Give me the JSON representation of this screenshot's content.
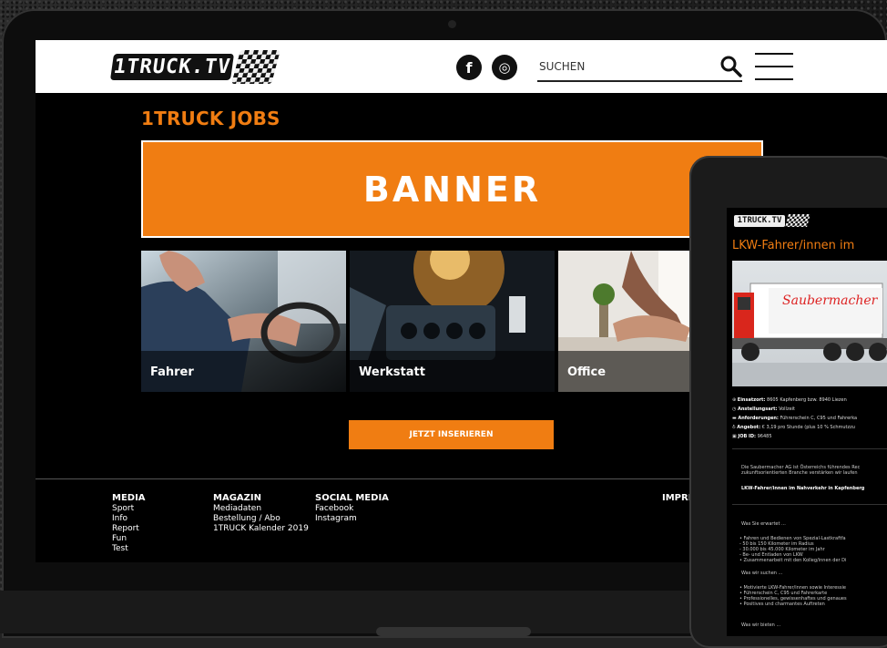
{
  "header": {
    "logo_text": "1TRUCK.TV",
    "social": [
      {
        "label": "f",
        "icon": "facebook-icon"
      },
      {
        "label": "◎",
        "icon": "instagram-icon"
      }
    ],
    "search_placeholder": "SUCHEN"
  },
  "main": {
    "title": "1TRUCK JOBS",
    "banner": "BANNER",
    "categories": [
      {
        "label": "Fahrer"
      },
      {
        "label": "Werkstatt"
      },
      {
        "label": "Office"
      }
    ],
    "cta": "JETZT INSERIEREN"
  },
  "footer": {
    "columns": [
      {
        "heading": "MEDIA",
        "items": [
          "Sport",
          "Info",
          "Report",
          "Fun",
          "Test"
        ]
      },
      {
        "heading": "MAGAZIN",
        "items": [
          "Mediadaten",
          "Bestellung / Abo",
          "1TRUCK Kalender 2019"
        ]
      },
      {
        "heading": "SOCIAL MEDIA",
        "items": [
          "Facebook",
          "Instagram"
        ]
      },
      {
        "heading": "IMPRI",
        "items": []
      }
    ]
  },
  "tablet": {
    "logo_text": "1TRUCK.TV",
    "title": "LKW-Fahrer/innen im",
    "truck_text": "Saubermacher",
    "meta": [
      {
        "k": "Einsatzort:",
        "v": " 8605 Kapfenberg bzw. 8940 Liezen"
      },
      {
        "k": "Anstellungsart:",
        "v": " Vollzeit"
      },
      {
        "k": "Anforderungen:",
        "v": " Führerschein C, C95 und Fahrerka"
      },
      {
        "k": "Angebot:",
        "v": " € 3,19 pro Stunde (plus 10 % Schmutzzu"
      },
      {
        "k": "JOB ID:",
        "v": " 96485"
      }
    ],
    "intro": [
      "Die Saubermacher AG ist Österreichs führendes Rec",
      "zukunftsorientierten Branche verstärken wir laufen"
    ],
    "subheading": "LKW-Fahrer/innen im Nahverkehr in Kapfenberg",
    "section1": "Was Sie erwartet ...",
    "list1": [
      "• Fahren und Bedienen von Spezial-Lastkraftfa",
      "  - 50 bis 150 Kilometer im Radius",
      "  - 30.000 bis 45.000 Kilometer im Jahr",
      "  - Be- und Entladen von LKW",
      "• Zusammenarbeit mit den Kolleg/innen der Di"
    ],
    "section2": "Was wir suchen ...",
    "list2": [
      "• Motivierte LKW-Fahrer/innen sowie Interessie",
      "• Führerschein C, C95 und Fahrerkarte",
      "• Professionelles, gewissenhaftes und genaues",
      "• Positives und charmantes Auftreten"
    ],
    "section3": "Was wir bieten ..."
  },
  "colors": {
    "accent": "#f07d12",
    "background": "#000000",
    "header": "#ffffff"
  }
}
